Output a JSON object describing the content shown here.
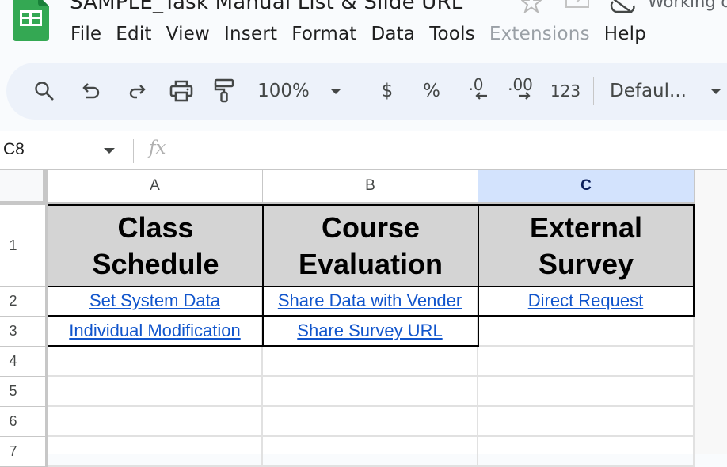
{
  "app": {
    "document_title": "SAMPLE_Task Manual List & Slide URL",
    "status": "Working o",
    "icons": [
      "sheets-logo-icon",
      "star-icon",
      "move-to-folder-icon",
      "cloud-offline-icon"
    ]
  },
  "menu": {
    "items": [
      {
        "label": "File",
        "disabled": false
      },
      {
        "label": "Edit",
        "disabled": false
      },
      {
        "label": "View",
        "disabled": false
      },
      {
        "label": "Insert",
        "disabled": false
      },
      {
        "label": "Format",
        "disabled": false
      },
      {
        "label": "Data",
        "disabled": false
      },
      {
        "label": "Tools",
        "disabled": false
      },
      {
        "label": "Extensions",
        "disabled": true
      },
      {
        "label": "Help",
        "disabled": false
      }
    ]
  },
  "toolbar": {
    "zoom": "100%",
    "currency": "$",
    "percent": "%",
    "decrease_decimal": ".0",
    "increase_decimal": ".00",
    "number_format": "123",
    "font": "Defaul..."
  },
  "formula_bar": {
    "name_box": "C8",
    "fx_label": "fx",
    "value": ""
  },
  "sheet": {
    "selected_column": "C",
    "columns": [
      "A",
      "B",
      "C"
    ],
    "rows": [
      "1",
      "2",
      "3",
      "4",
      "5",
      "6",
      "7"
    ],
    "header_row": [
      "Class Schedule",
      "Course Evaluation",
      "External Survey"
    ],
    "header_lines": [
      [
        "Class",
        "Schedule"
      ],
      [
        "Course",
        "Evaluation"
      ],
      [
        "External",
        "Survey"
      ]
    ],
    "links": {
      "A2": "Set System Data",
      "B2": "Share Data with Vender",
      "C2": "Direct Request",
      "A3": "Individual Modification",
      "B3": "Share Survey URL"
    },
    "colors": {
      "header_fill": "#d4d4d4",
      "link": "#1155cc",
      "selected_column_header": "#d3e3fd",
      "sheets_green": "#34a853"
    }
  }
}
